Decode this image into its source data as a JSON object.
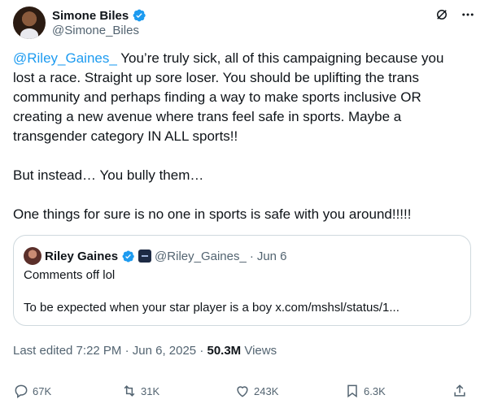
{
  "author": {
    "name": "Simone Biles",
    "handle": "@Simone_Biles"
  },
  "tweet": {
    "mention": "@Riley_Gaines_",
    "text_1": " You’re truly sick, all of this campaigning because you lost a race. Straight up sore loser. You should be uplifting the trans community and perhaps finding a way to make sports inclusive OR creating a new avenue where trans feel safe in sports. Maybe a transgender category IN ALL sports!!",
    "text_2": "But instead… You bully them…",
    "text_3": "One things for sure is no one in sports is safe with you around!!!!!"
  },
  "quote": {
    "name": "Riley Gaines",
    "handle": "@Riley_Gaines_",
    "separator": "·",
    "date": "Jun 6",
    "line_1": "Comments off lol",
    "line_2": "To be expected when your star player is a boy x.com/mshsl/status/1..."
  },
  "meta": {
    "edited": "Last edited 7:22 PM · Jun 6, 2025 · ",
    "views_count": "50.3M",
    "views_label": " Views"
  },
  "actions": {
    "replies": "67K",
    "reposts": "31K",
    "likes": "243K",
    "bookmarks": "6.3K"
  },
  "colors": {
    "accent": "#1d9bf0",
    "text": "#0f1419",
    "secondary": "#536471",
    "border": "#cfd9de"
  },
  "icons": [
    "verified-badge-icon",
    "grok-icon",
    "more-icon",
    "affiliate-badge-icon",
    "reply-icon",
    "repost-icon",
    "like-icon",
    "bookmark-icon",
    "share-icon"
  ]
}
